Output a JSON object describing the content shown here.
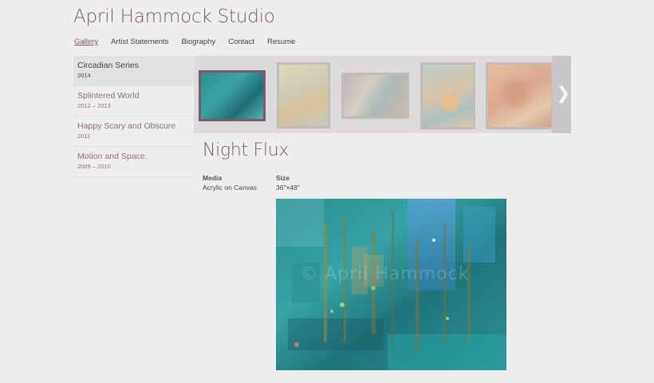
{
  "site": {
    "title": "April Hammock Studio"
  },
  "nav": [
    {
      "label": "Gallery",
      "active": true
    },
    {
      "label": "Artist Statements"
    },
    {
      "label": "Biography"
    },
    {
      "label": "Contact"
    },
    {
      "label": "Resume"
    }
  ],
  "series": [
    {
      "name": "Circadian Series",
      "years": "2014",
      "active": true
    },
    {
      "name": "Splintered World",
      "years": "2012 – 2013"
    },
    {
      "name": "Happy Scary and Obscure",
      "years": "2011"
    },
    {
      "name": "Motion and Space.",
      "years": "2009 – 2010"
    }
  ],
  "artwork": {
    "title": "Night Flux",
    "media_label": "Media",
    "media_value": "Acrylic on Canvas",
    "size_label": "Size",
    "size_value": "36\"×48\"",
    "watermark": "© April Hammock"
  },
  "colors": {
    "accent": "#7a5b67"
  },
  "icons": {
    "next": "chevron-right-icon"
  }
}
